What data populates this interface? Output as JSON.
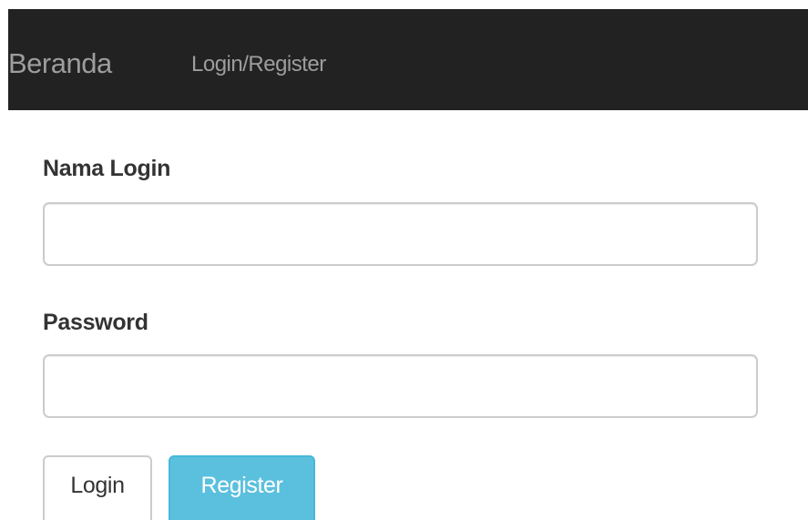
{
  "navbar": {
    "brand": "Beranda",
    "links": [
      {
        "label": "Login/Register"
      }
    ]
  },
  "form": {
    "username": {
      "label": "Nama Login",
      "value": "",
      "placeholder": ""
    },
    "password": {
      "label": "Password",
      "value": "",
      "placeholder": ""
    },
    "buttons": {
      "login_label": "Login",
      "register_label": "Register"
    }
  },
  "colors": {
    "navbar_background": "#222222",
    "navbar_text": "#9d9d9d",
    "register_button": "#5bc0de",
    "label_text": "#333333",
    "input_border": "#cccccc"
  }
}
